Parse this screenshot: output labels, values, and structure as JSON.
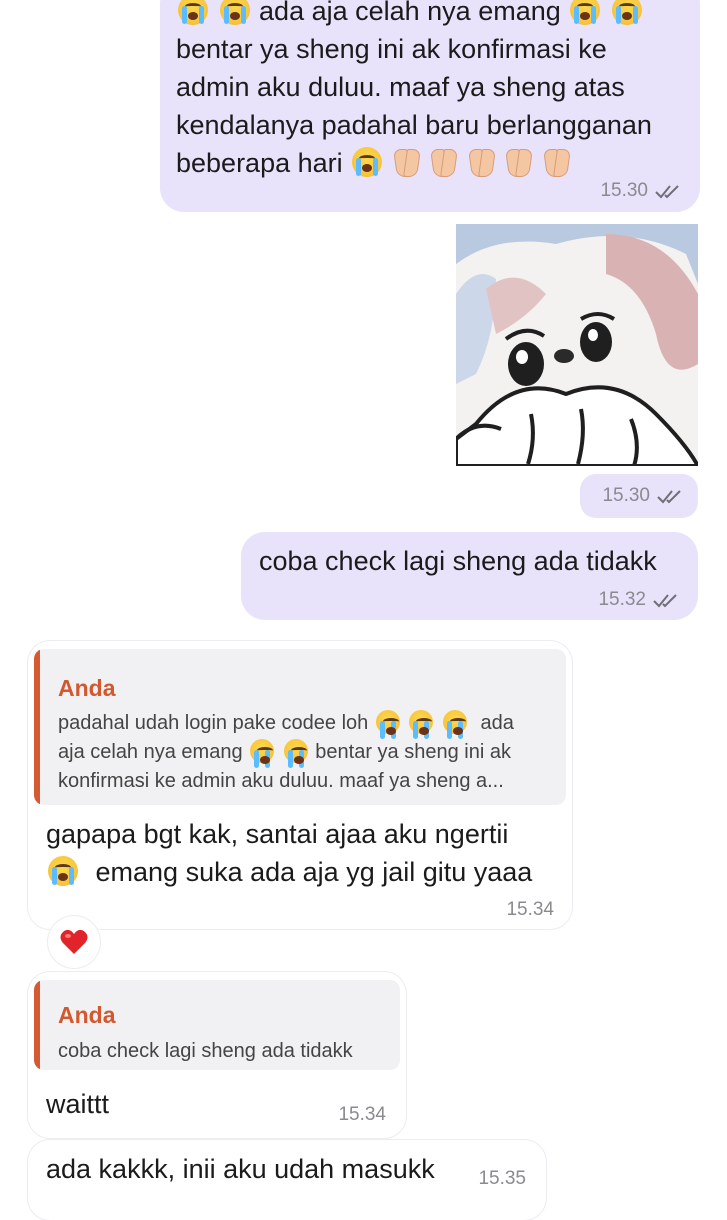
{
  "messages": {
    "msg1": {
      "lines": [
        "ada aja celah nya emang",
        "bentar ya sheng ini ak konfirmasi ke",
        "admin aku duluu. maaf ya sheng atas",
        "kendalanya padahal baru berlangganan",
        "beberapa hari"
      ],
      "time": "15.30"
    },
    "sticker": {
      "time": "15.30"
    },
    "msg2": {
      "text": "coba check lagi sheng ada tidakk",
      "time": "15.32"
    },
    "reply1": {
      "quote_author": "Anda",
      "quote_lines": [
        "padahal udah login pake codee loh",
        "aja celah nya emang",
        "bentar ya sheng ini ak",
        "konfirmasi ke admin aku duluu. maaf ya sheng a..."
      ],
      "quote_ada": "ada",
      "text_line1": "gapapa bgt kak, santai ajaa aku ngertii",
      "text_line2": "emang suka ada aja yg jail gitu yaaa",
      "time": "15.34",
      "reaction": "heart"
    },
    "reply2": {
      "quote_author": "Anda",
      "quote_text": "coba check lagi sheng ada tidakk",
      "text": "waittt",
      "time": "15.34"
    },
    "msg3": {
      "text": "ada kakkk, inii aku udah masukk",
      "time": "15.35"
    }
  },
  "colors": {
    "outgoing_bubble": "#e8e2fb",
    "incoming_bubble": "#ffffff",
    "quote_accent": "#d45a34",
    "quote_author": "#d2582f",
    "time": "#8a8a8f",
    "heart": "#e0242a"
  },
  "icons": {
    "read_receipt": "double-check-icon",
    "reaction": "heart-icon",
    "emoji_crying": "loudly-crying-face-emoji",
    "emoji_pray": "folded-hands-emoji"
  }
}
